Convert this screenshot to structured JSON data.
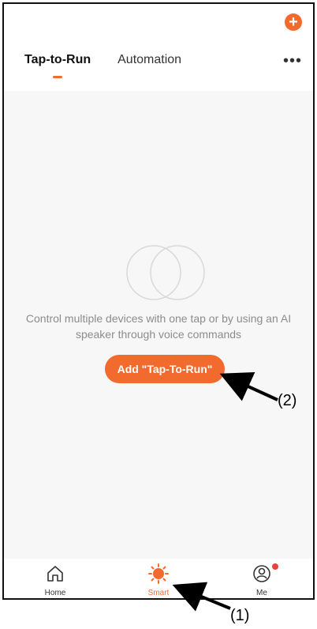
{
  "header": {
    "add_icon": "plus-icon",
    "add_glyph": "+",
    "tabs": [
      {
        "label": "Tap-to-Run",
        "active": true
      },
      {
        "label": "Automation",
        "active": false
      }
    ],
    "more_glyph": "•••"
  },
  "empty_state": {
    "icon": "two-circles-icon",
    "message": "Control multiple devices with one tap or by using an AI speaker through voice commands",
    "button_label": "Add \"Tap-To-Run\""
  },
  "bottom_nav": {
    "items": [
      {
        "label": "Home",
        "icon": "home-icon"
      },
      {
        "label": "Smart",
        "icon": "sun-icon",
        "active": true
      },
      {
        "label": "Me",
        "icon": "user-icon",
        "has_badge": true
      }
    ]
  },
  "annotations": {
    "label_1": "(1)",
    "label_2": "(2)"
  },
  "colors": {
    "accent": "#f26a2e",
    "badge": "#e8423b",
    "background": "#f7f7f7"
  }
}
